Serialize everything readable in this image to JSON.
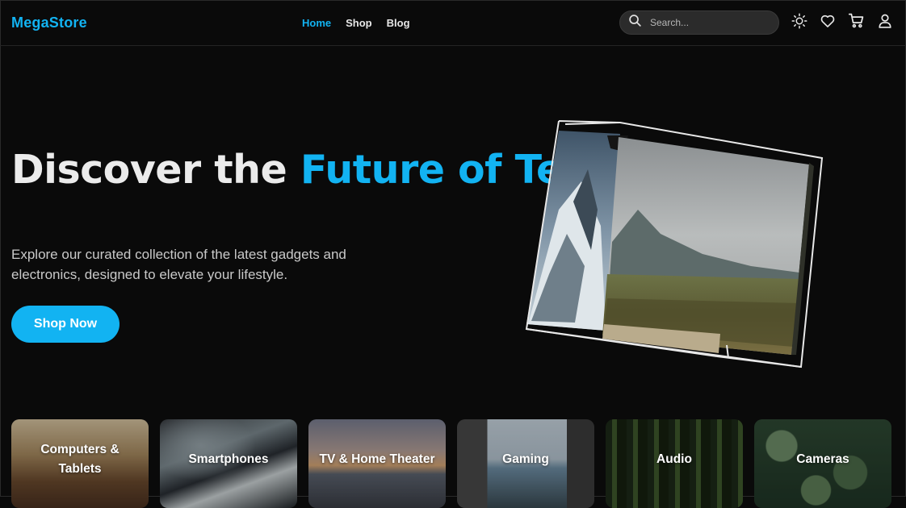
{
  "brand": {
    "name": "MegaStore",
    "accent": "#12b3f2"
  },
  "nav": [
    {
      "label": "Home",
      "active": true
    },
    {
      "label": "Shop",
      "active": false
    },
    {
      "label": "Blog",
      "active": false
    }
  ],
  "search": {
    "placeholder": "Search...",
    "value": ""
  },
  "header_icons": [
    "sun-icon",
    "heart-icon",
    "cart-icon",
    "user-icon"
  ],
  "hero": {
    "title_part1": "Discover the ",
    "title_accent": "Future of Tech",
    "subtitle": "Explore our curated collection of the latest gadgets and electronics, designed to elevate your lifestyle.",
    "cta_label": "Shop Now"
  },
  "categories": [
    {
      "label": "Computers & Tablets"
    },
    {
      "label": "Smartphones"
    },
    {
      "label": "TV & Home Theater"
    },
    {
      "label": "Gaming"
    },
    {
      "label": "Audio"
    },
    {
      "label": "Cameras"
    }
  ]
}
